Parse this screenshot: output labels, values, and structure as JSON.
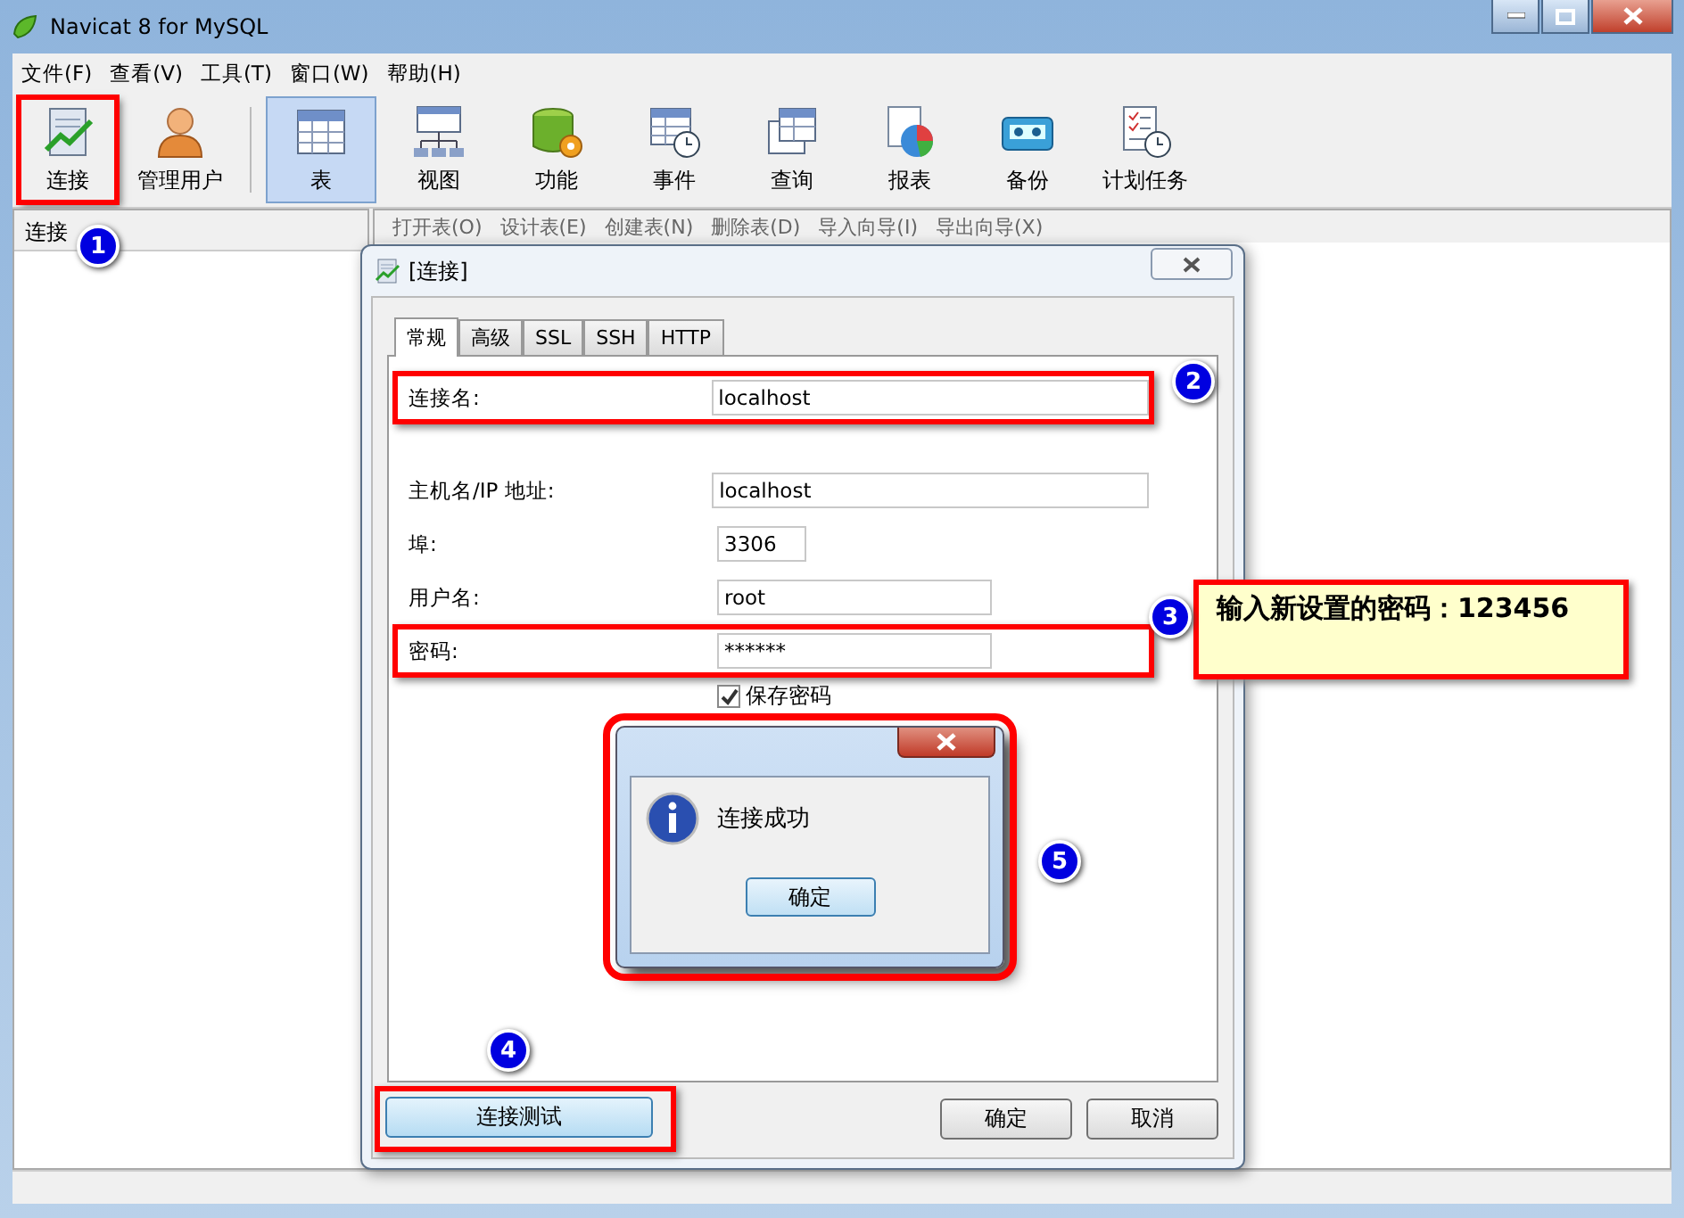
{
  "window": {
    "title": "Navicat 8 for MySQL"
  },
  "menu": [
    "文件(F)",
    "查看(V)",
    "工具(T)",
    "窗口(W)",
    "帮助(H)"
  ],
  "toolbar": [
    {
      "label": "连接",
      "selected": false,
      "highlighted": true
    },
    {
      "label": "管理用户",
      "selected": false,
      "highlighted": false
    },
    {
      "label": "表",
      "selected": true,
      "highlighted": false
    },
    {
      "label": "视图",
      "selected": false,
      "highlighted": false
    },
    {
      "label": "功能",
      "selected": false,
      "highlighted": false
    },
    {
      "label": "事件",
      "selected": false,
      "highlighted": false
    },
    {
      "label": "查询",
      "selected": false,
      "highlighted": false
    },
    {
      "label": "报表",
      "selected": false,
      "highlighted": false
    },
    {
      "label": "备份",
      "selected": false,
      "highlighted": false
    },
    {
      "label": "计划任务",
      "selected": false,
      "highlighted": false
    }
  ],
  "sidebar": {
    "title": "连接"
  },
  "object_toolbar": [
    "打开表(O)",
    "设计表(E)",
    "创建表(N)",
    "删除表(D)",
    "导入向导(I)",
    "导出向导(X)"
  ],
  "dialog": {
    "title": "[连接]",
    "tabs": [
      {
        "label": "常规",
        "selected": true
      },
      {
        "label": "高级",
        "selected": false
      },
      {
        "label": "SSL",
        "selected": false
      },
      {
        "label": "SSH",
        "selected": false
      },
      {
        "label": "HTTP",
        "selected": false
      }
    ],
    "fields": [
      {
        "label": "连接名:",
        "value": "localhost",
        "highlighted": true
      },
      {
        "label": "主机名/IP 地址:",
        "value": "localhost",
        "highlighted": false
      },
      {
        "label": "埠:",
        "value": "3306",
        "highlighted": false
      },
      {
        "label": "用户名:",
        "value": "root",
        "highlighted": false
      },
      {
        "label": "密码:",
        "value": "******",
        "highlighted": true
      }
    ],
    "save_password": {
      "label": "保存密码",
      "checked": true
    },
    "test_button": {
      "label": "连接测试",
      "highlighted": true
    },
    "ok_button": "确定",
    "cancel_button": "取消"
  },
  "message_box": {
    "text": "连接成功",
    "button": "确定",
    "highlighted": true
  },
  "callout": {
    "text": "输入新设置的密码：123456"
  },
  "markers": [
    "1",
    "2",
    "3",
    "4",
    "5"
  ]
}
